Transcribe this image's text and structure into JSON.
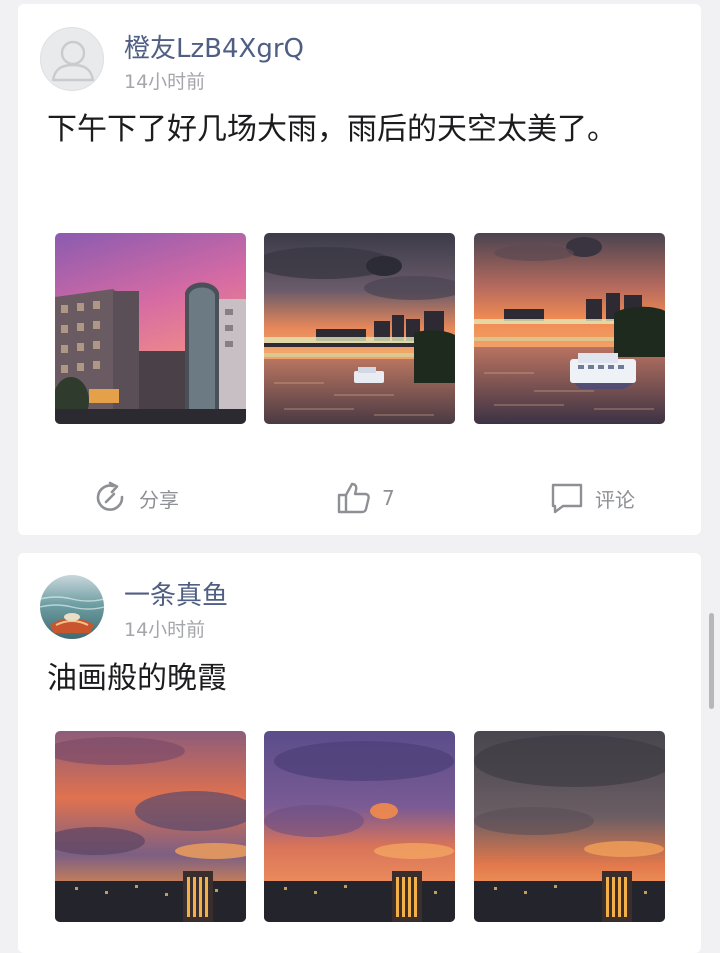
{
  "posts": [
    {
      "username": "橙友LzB4XgrQ",
      "time": "14小时前",
      "text": "下午下了好几场大雨，雨后的天空太美了。",
      "actions": {
        "share_label": "分享",
        "like_count": "7",
        "comment_label": "评论"
      }
    },
    {
      "username": "一条真鱼",
      "time": "14小时前",
      "text": "油画般的晚霞"
    }
  ],
  "icons": {
    "share": "share-icon",
    "like": "thumbs-up-icon",
    "comment": "comment-icon"
  },
  "colors": {
    "username": "#4f5f83",
    "timestamp": "#a4a6ab",
    "action_gray": "#8e9095"
  }
}
